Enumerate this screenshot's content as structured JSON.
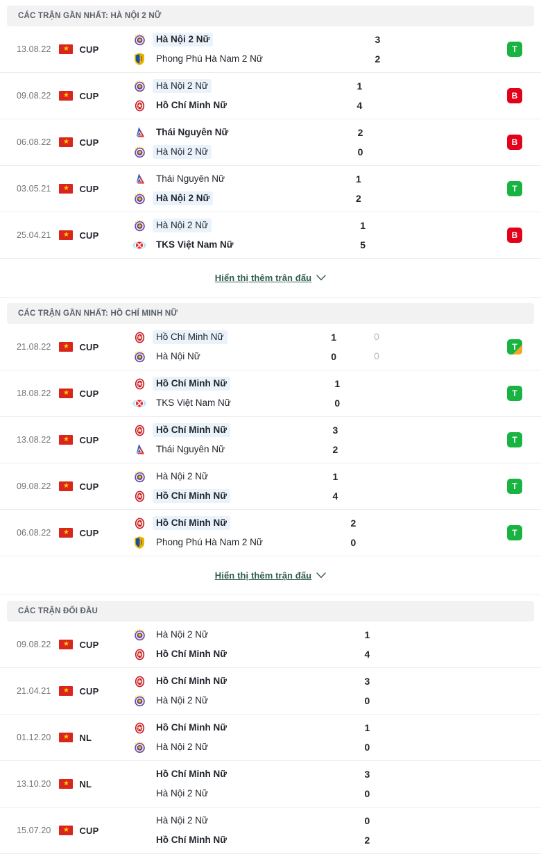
{
  "sections": [
    {
      "id": "recent-home",
      "title": "CÁC TRẬN GẦN NHẤT: HÀ NỘI 2 NỮ",
      "has_secondary_score": false,
      "show_more": {
        "label": "Hiển thị thêm trận đấu",
        "icon": "chevron-down-icon"
      },
      "matches": [
        {
          "date": "13.08.22",
          "competition": "CUP",
          "flag": "vn-flag-icon",
          "home": {
            "name": "Hà Nội 2 Nữ",
            "logo": "hanoi-crest-icon",
            "bold": true,
            "highlight": true,
            "score": "3",
            "score2": ""
          },
          "away": {
            "name": "Phong Phú Hà Nam 2 Nữ",
            "logo": "phongphu-shield-icon",
            "bold": false,
            "highlight": false,
            "score": "2",
            "score2": ""
          },
          "result": {
            "letter": "T",
            "type": "win",
            "corner": false
          }
        },
        {
          "date": "09.08.22",
          "competition": "CUP",
          "flag": "vn-flag-icon",
          "home": {
            "name": "Hà Nội 2 Nữ",
            "logo": "hanoi-crest-icon",
            "bold": false,
            "highlight": true,
            "score": "1",
            "score2": ""
          },
          "away": {
            "name": "Hồ Chí Minh Nữ",
            "logo": "hcm-crest-icon",
            "bold": true,
            "highlight": false,
            "score": "4",
            "score2": ""
          },
          "result": {
            "letter": "B",
            "type": "loss",
            "corner": false
          }
        },
        {
          "date": "06.08.22",
          "competition": "CUP",
          "flag": "vn-flag-icon",
          "home": {
            "name": "Thái Nguyên Nữ",
            "logo": "thainguyen-icon",
            "bold": true,
            "highlight": false,
            "score": "2",
            "score2": ""
          },
          "away": {
            "name": "Hà Nội 2 Nữ",
            "logo": "hanoi-crest-icon",
            "bold": false,
            "highlight": true,
            "score": "0",
            "score2": ""
          },
          "result": {
            "letter": "B",
            "type": "loss",
            "corner": false
          }
        },
        {
          "date": "03.05.21",
          "competition": "CUP",
          "flag": "vn-flag-icon",
          "home": {
            "name": "Thái Nguyên Nữ",
            "logo": "thainguyen-icon",
            "bold": false,
            "highlight": false,
            "score": "1",
            "score2": ""
          },
          "away": {
            "name": "Hà Nội 2 Nữ",
            "logo": "hanoi-crest-icon",
            "bold": true,
            "highlight": true,
            "score": "2",
            "score2": ""
          },
          "result": {
            "letter": "T",
            "type": "win",
            "corner": false
          }
        },
        {
          "date": "25.04.21",
          "competition": "CUP",
          "flag": "vn-flag-icon",
          "home": {
            "name": "Hà Nội 2 Nữ",
            "logo": "hanoi-crest-icon",
            "bold": false,
            "highlight": true,
            "score": "1",
            "score2": ""
          },
          "away": {
            "name": "TKS Việt Nam Nữ",
            "logo": "tks-icon",
            "bold": true,
            "highlight": false,
            "score": "5",
            "score2": ""
          },
          "result": {
            "letter": "B",
            "type": "loss",
            "corner": false
          }
        }
      ]
    },
    {
      "id": "recent-away",
      "title": "CÁC TRẬN GẦN NHẤT: HỒ CHÍ MINH NỮ",
      "has_secondary_score": true,
      "show_more": {
        "label": "Hiển thị thêm trận đấu",
        "icon": "chevron-down-icon"
      },
      "matches": [
        {
          "date": "21.08.22",
          "competition": "CUP",
          "flag": "vn-flag-icon",
          "home": {
            "name": "Hồ Chí Minh Nữ",
            "logo": "hcm-crest-icon",
            "bold": false,
            "highlight": true,
            "score": "1",
            "score2": "0"
          },
          "away": {
            "name": "Hà Nội Nữ",
            "logo": "hanoi-crest-icon",
            "bold": false,
            "highlight": false,
            "score": "0",
            "score2": "0"
          },
          "result": {
            "letter": "T",
            "type": "win",
            "corner": true
          }
        },
        {
          "date": "18.08.22",
          "competition": "CUP",
          "flag": "vn-flag-icon",
          "home": {
            "name": "Hồ Chí Minh Nữ",
            "logo": "hcm-crest-icon",
            "bold": true,
            "highlight": true,
            "score": "1",
            "score2": ""
          },
          "away": {
            "name": "TKS Việt Nam Nữ",
            "logo": "tks-icon",
            "bold": false,
            "highlight": false,
            "score": "0",
            "score2": ""
          },
          "result": {
            "letter": "T",
            "type": "win",
            "corner": false
          }
        },
        {
          "date": "13.08.22",
          "competition": "CUP",
          "flag": "vn-flag-icon",
          "home": {
            "name": "Hồ Chí Minh Nữ",
            "logo": "hcm-crest-icon",
            "bold": true,
            "highlight": true,
            "score": "3",
            "score2": ""
          },
          "away": {
            "name": "Thái Nguyên Nữ",
            "logo": "thainguyen-icon",
            "bold": false,
            "highlight": false,
            "score": "2",
            "score2": ""
          },
          "result": {
            "letter": "T",
            "type": "win",
            "corner": false
          }
        },
        {
          "date": "09.08.22",
          "competition": "CUP",
          "flag": "vn-flag-icon",
          "home": {
            "name": "Hà Nội 2 Nữ",
            "logo": "hanoi-crest-icon",
            "bold": false,
            "highlight": false,
            "score": "1",
            "score2": ""
          },
          "away": {
            "name": "Hồ Chí Minh Nữ",
            "logo": "hcm-crest-icon",
            "bold": true,
            "highlight": true,
            "score": "4",
            "score2": ""
          },
          "result": {
            "letter": "T",
            "type": "win",
            "corner": false
          }
        },
        {
          "date": "06.08.22",
          "competition": "CUP",
          "flag": "vn-flag-icon",
          "home": {
            "name": "Hồ Chí Minh Nữ",
            "logo": "hcm-crest-icon",
            "bold": true,
            "highlight": true,
            "score": "2",
            "score2": ""
          },
          "away": {
            "name": "Phong Phú Hà Nam 2 Nữ",
            "logo": "phongphu-shield-icon",
            "bold": false,
            "highlight": false,
            "score": "0",
            "score2": ""
          },
          "result": {
            "letter": "T",
            "type": "win",
            "corner": false
          }
        }
      ]
    },
    {
      "id": "head-to-head",
      "title": "CÁC TRẬN ĐỐI ĐẦU",
      "has_secondary_score": false,
      "show_more": null,
      "matches": [
        {
          "date": "09.08.22",
          "competition": "CUP",
          "flag": "vn-flag-icon",
          "home": {
            "name": "Hà Nội 2 Nữ",
            "logo": "hanoi-crest-icon",
            "bold": false,
            "highlight": false,
            "score": "1",
            "score2": ""
          },
          "away": {
            "name": "Hồ Chí Minh Nữ",
            "logo": "hcm-crest-icon",
            "bold": true,
            "highlight": false,
            "score": "4",
            "score2": ""
          },
          "result": null
        },
        {
          "date": "21.04.21",
          "competition": "CUP",
          "flag": "vn-flag-icon",
          "home": {
            "name": "Hồ Chí Minh Nữ",
            "logo": "hcm-crest-icon",
            "bold": true,
            "highlight": false,
            "score": "3",
            "score2": ""
          },
          "away": {
            "name": "Hà Nội 2 Nữ",
            "logo": "hanoi-crest-icon",
            "bold": false,
            "highlight": false,
            "score": "0",
            "score2": ""
          },
          "result": null
        },
        {
          "date": "01.12.20",
          "competition": "NL",
          "flag": "vn-flag-icon",
          "home": {
            "name": "Hồ Chí Minh Nữ",
            "logo": "hcm-crest-icon",
            "bold": true,
            "highlight": false,
            "score": "1",
            "score2": ""
          },
          "away": {
            "name": "Hà Nội 2 Nữ",
            "logo": "hanoi-crest-icon",
            "bold": false,
            "highlight": false,
            "score": "0",
            "score2": ""
          },
          "result": null
        },
        {
          "date": "13.10.20",
          "competition": "NL",
          "flag": "vn-flag-icon",
          "home": {
            "name": "Hồ Chí Minh Nữ",
            "logo": "",
            "bold": true,
            "highlight": false,
            "score": "3",
            "score2": ""
          },
          "away": {
            "name": "Hà Nội 2 Nữ",
            "logo": "",
            "bold": false,
            "highlight": false,
            "score": "0",
            "score2": ""
          },
          "result": null
        },
        {
          "date": "15.07.20",
          "competition": "CUP",
          "flag": "vn-flag-icon",
          "home": {
            "name": "Hà Nội 2 Nữ",
            "logo": "",
            "bold": false,
            "highlight": false,
            "score": "0",
            "score2": ""
          },
          "away": {
            "name": "Hồ Chí Minh Nữ",
            "logo": "",
            "bold": true,
            "highlight": false,
            "score": "2",
            "score2": ""
          },
          "result": null
        }
      ]
    }
  ],
  "colors": {
    "win": "#19b341",
    "loss": "#e2001a",
    "penalty_corner": "#f5a623",
    "header_bg": "#f2f2f2",
    "link": "#2f5d4c",
    "highlight": "#eaf2fb",
    "flag_red": "#da251d",
    "flag_star": "#ffcd00"
  }
}
